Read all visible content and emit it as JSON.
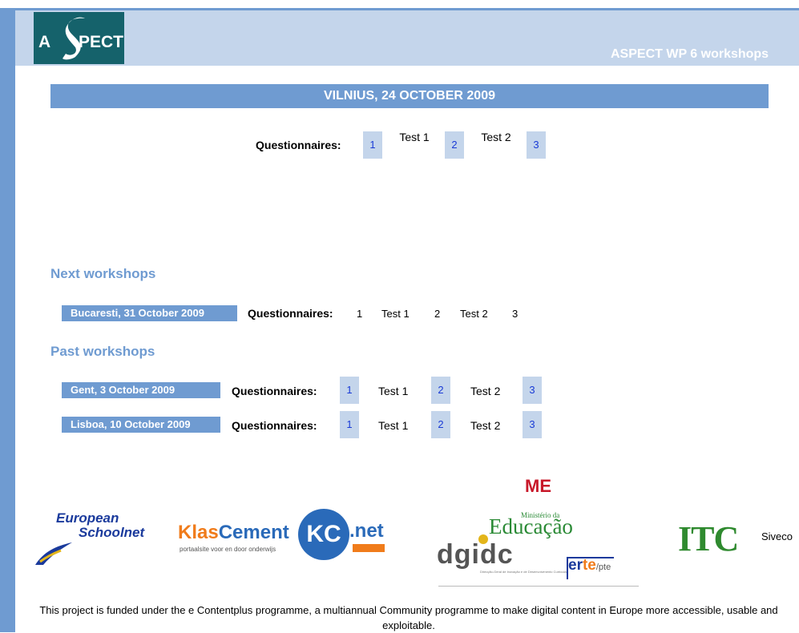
{
  "header": {
    "logo_left": "A",
    "logo_right": "PECT",
    "site_title": "ASPECT WP 6 workshops"
  },
  "current_event": {
    "title": "VILNIUS, 24 OCTOBER 2009",
    "questionnaires_label": "Questionnaires:",
    "links": [
      "1",
      "2",
      "3"
    ],
    "tests": [
      "Test 1",
      "Test 2"
    ]
  },
  "next_workshops": {
    "heading": "Next workshops",
    "items": [
      {
        "label": "Bucaresti, 31 October 2009",
        "questionnaires_label": "Questionnaires:",
        "q1": "1",
        "test1": "Test 1",
        "q2": "2",
        "test2": "Test 2",
        "q3": "3"
      }
    ]
  },
  "past_workshops": {
    "heading": "Past workshops",
    "items": [
      {
        "label": "Gent, 3 October 2009",
        "questionnaires_label": "Questionnaires:",
        "q1": "1",
        "test1": "Test 1",
        "q2": "2",
        "test2": "Test 2",
        "q3": "3"
      },
      {
        "label": "Lisboa, 10 October 2009",
        "questionnaires_label": "Questionnaires:",
        "q1": "1",
        "test1": "Test 1",
        "q2": "2",
        "test2": "Test 2",
        "q3": "3"
      }
    ]
  },
  "sponsors": {
    "european_schoolnet": [
      "European",
      "Schoolnet"
    ],
    "klascement": {
      "name_a": "Klas",
      "name_b": "Cement",
      "initials": "KC",
      "net": ".net",
      "tagline": "portaalsite voor en door onderwijs"
    },
    "ministerio": {
      "mark": "ME",
      "small": "Ministério da",
      "big": "Educação"
    },
    "dgidc": {
      "name": "dgidc",
      "fine": "Direcção-Geral de Inovação e de Desenvolvimento Curricular",
      "erte_a": "er",
      "erte_b": "te",
      "pte": "/pte"
    },
    "itc": "ITC",
    "siveco": "Siveco"
  },
  "footer": {
    "text": "This project is funded under the e Contentplus programme, a multiannual Community programme to make digital content in Europe more accessible, usable and exploitable."
  },
  "colors": {
    "accent": "#6f9bd1",
    "header_band": "#c4d5eb",
    "logo": "#15626b",
    "link": "#1a3bd6"
  }
}
